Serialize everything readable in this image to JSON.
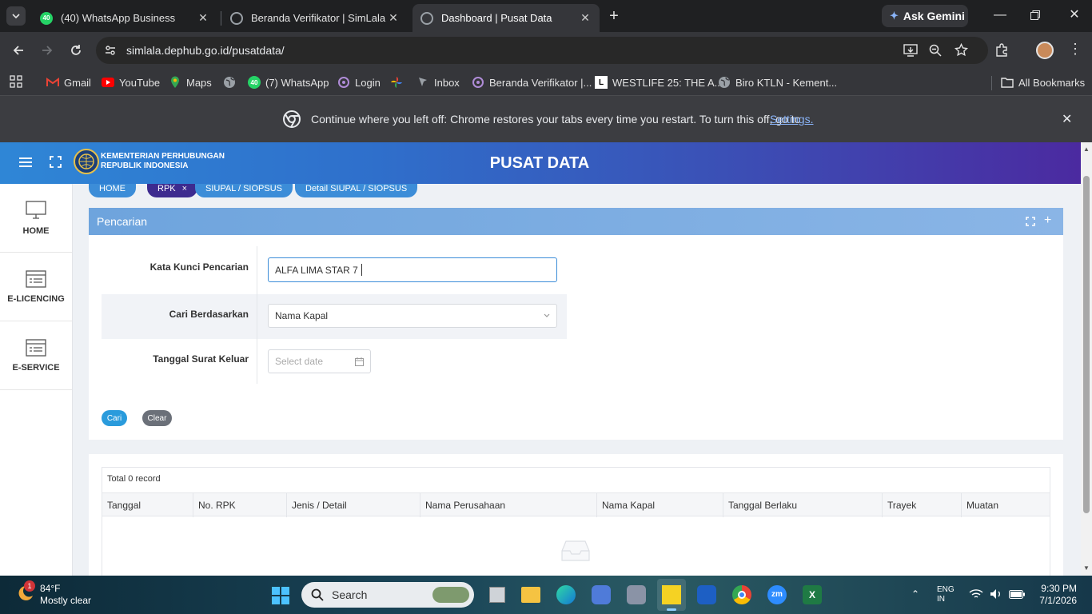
{
  "browser": {
    "tabs": [
      {
        "title": "(40) WhatsApp Business",
        "favicon_badge": "40"
      },
      {
        "title": "Beranda Verifikator | SimLala"
      },
      {
        "title": "Dashboard | Pusat Data"
      }
    ],
    "ask_gemini": "Ask Gemini",
    "url": "simlala.dephub.go.id/pusatdata/",
    "bookmarks": [
      {
        "label": "Gmail",
        "icon": "gmail-icon"
      },
      {
        "label": "YouTube",
        "icon": "youtube-icon"
      },
      {
        "label": "Maps",
        "icon": "maps-icon"
      },
      {
        "label": "",
        "icon": "globe-icon"
      },
      {
        "label": "(7) WhatsApp",
        "icon": "whatsapp-icon",
        "badge": "40"
      },
      {
        "label": "Login",
        "icon": "login-site-icon"
      },
      {
        "label": "",
        "icon": "pinwheel-icon"
      },
      {
        "label": "Inbox",
        "icon": "inbox-icon"
      },
      {
        "label": "Beranda Verifikator |...",
        "icon": "simlala-icon"
      },
      {
        "label": "WESTLIFE 25: THE A...",
        "icon": "westlife-icon"
      },
      {
        "label": "Biro KTLN - Kement...",
        "icon": "globe-icon"
      }
    ],
    "all_bookmarks": "All Bookmarks",
    "infobar": {
      "text": "Continue where you left off: Chrome restores your tabs every time you restart. To turn this off, go to",
      "link": "Settings."
    }
  },
  "app": {
    "org_line1": "KEMENTERIAN PERHUBUNGAN",
    "org_line2": "REPUBLIK INDONESIA",
    "title": "PUSAT DATA",
    "nav": [
      {
        "label": "HOME",
        "icon": "monitor-icon"
      },
      {
        "label": "E-LICENCING",
        "icon": "license-card-icon"
      },
      {
        "label": "E-SERVICE",
        "icon": "service-card-icon"
      }
    ],
    "breadcrumb_tabs": [
      {
        "label": "HOME"
      },
      {
        "label": "RPK",
        "closable": "×"
      },
      {
        "label": "SIUPAL / SIOPSUS"
      },
      {
        "label": "Detail SIUPAL / SIOPSUS"
      }
    ],
    "search_panel": {
      "title": "Pencarian",
      "keyword_label": "Kata Kunci Pencarian",
      "keyword_value": "ALFA LIMA STAR 7",
      "searchby_label": "Cari Berdasarkan",
      "searchby_value": "Nama Kapal",
      "date_label": "Tanggal Surat Keluar",
      "date_placeholder": "Select date",
      "search_button": "Cari",
      "clear_button": "Clear"
    },
    "table": {
      "total": "Total 0 record",
      "columns": [
        "Tanggal",
        "No. RPK",
        "Jenis / Detail",
        "Nama Perusahaan",
        "Nama Kapal",
        "Tanggal Berlaku",
        "Trayek",
        "Muatan"
      ]
    }
  },
  "taskbar": {
    "weather_temp": "84°F",
    "weather_desc": "Mostly clear",
    "weather_badge": "1",
    "search_placeholder": "Search",
    "lang": "ENG",
    "lang_sub": "IN",
    "time": "9:30 PM",
    "date": "7/1/2026"
  },
  "colors": {
    "header_gradient_start": "#2f86d6",
    "header_gradient_end": "#4b2aa0",
    "active_tab_pill": "#3d2b8f",
    "tab_pill": "#3c8dd8",
    "search_button": "#2a9bdc",
    "clear_button": "#6b7079"
  }
}
